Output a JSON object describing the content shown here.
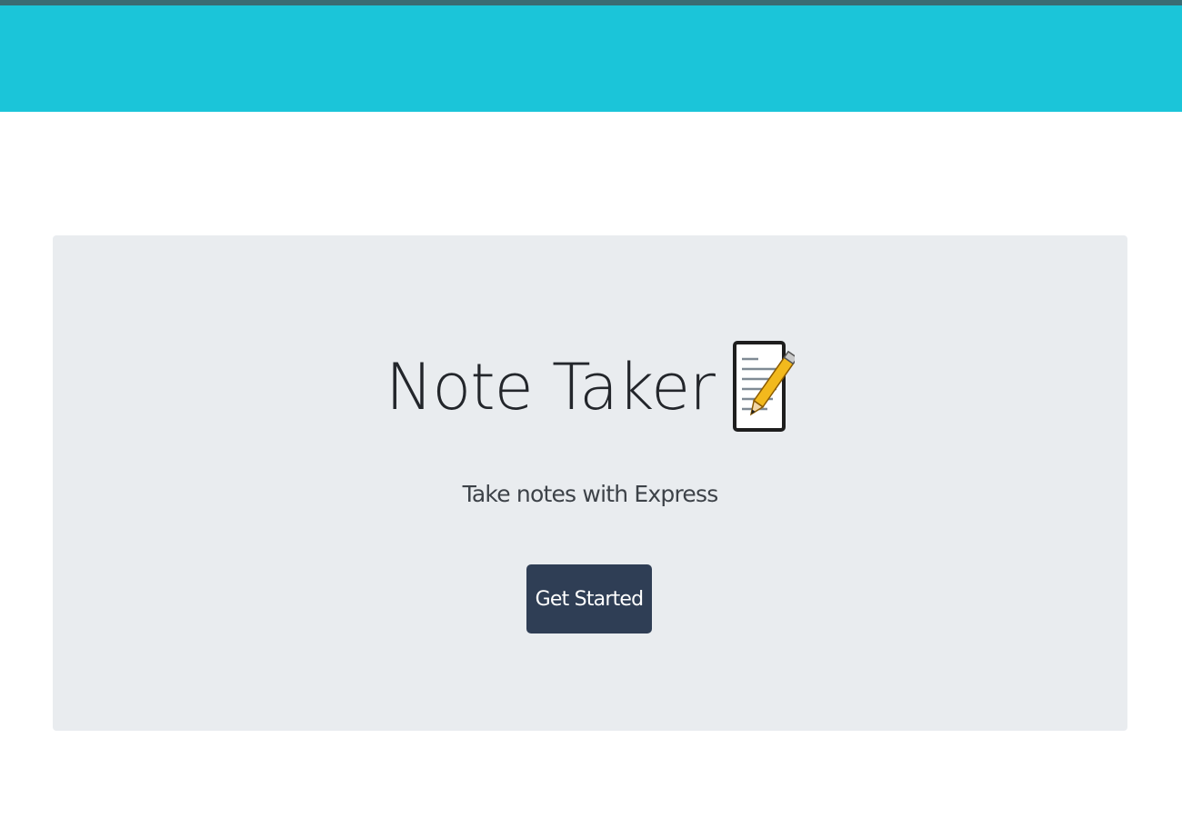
{
  "header": {
    "brand_color": "#1bc5d9"
  },
  "hero": {
    "title": "Note Taker",
    "title_icon": "memo-icon",
    "subtitle": "Take notes with Express",
    "cta_label": "Get Started"
  },
  "colors": {
    "hero_background": "#e9ecef",
    "button_background": "#2f3e55"
  }
}
